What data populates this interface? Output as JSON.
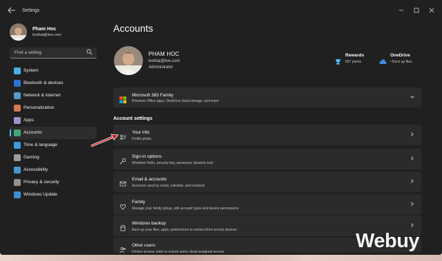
{
  "window": {
    "app_title": "Settings",
    "back_icon": "arrow-left-icon",
    "controls": [
      "minimize-icon",
      "maximize-icon",
      "close-icon"
    ]
  },
  "profile": {
    "name": "Pham Hoc",
    "email": "lexthai@live.com"
  },
  "search": {
    "placeholder": "Find a setting",
    "icon": "search-icon"
  },
  "nav": [
    {
      "label": "System",
      "icon": "monitor-icon",
      "color": "#4cc2ff",
      "active": false
    },
    {
      "label": "Bluetooth & devices",
      "icon": "bluetooth-icon",
      "color": "#2f7de1",
      "active": false
    },
    {
      "label": "Network & internet",
      "icon": "wifi-icon",
      "color": "#5aa9e6",
      "active": false
    },
    {
      "label": "Personalization",
      "icon": "brush-icon",
      "color": "#e9825a",
      "active": false
    },
    {
      "label": "Apps",
      "icon": "apps-icon",
      "color": "#b39ddb",
      "active": false
    },
    {
      "label": "Accounts",
      "icon": "person-icon",
      "color": "#43b581",
      "active": true
    },
    {
      "label": "Time & language",
      "icon": "globe-clock-icon",
      "color": "#3fa9f5",
      "active": false
    },
    {
      "label": "Gaming",
      "icon": "gamepad-icon",
      "color": "#a8a8a8",
      "active": false
    },
    {
      "label": "Accessibility",
      "icon": "accessibility-icon",
      "color": "#4aa3df",
      "active": false
    },
    {
      "label": "Privacy & security",
      "icon": "shield-icon",
      "color": "#9e9e9e",
      "active": false
    },
    {
      "label": "Windows Update",
      "icon": "update-icon",
      "color": "#3d9be9",
      "active": false
    }
  ],
  "main": {
    "title": "Accounts",
    "account": {
      "name": "PHAM HOC",
      "email": "lexthai@live.com",
      "role": "Administrator"
    },
    "rewards": {
      "title": "Rewards",
      "sub": "657 points",
      "icon": "rewards-trophy-icon"
    },
    "onedrive": {
      "title": "OneDrive",
      "sub": "• Back up files",
      "icon": "cloud-icon"
    },
    "m365": {
      "title": "Microsoft 365 Family",
      "sub": "Premium Office apps, OneDrive cloud storage, and more",
      "icon": "microsoft-logo-icon"
    },
    "section_title": "Account settings",
    "settings": [
      {
        "title": "Your info",
        "sub": "Profile photo",
        "icon": "person-card-icon"
      },
      {
        "title": "Sign-in options",
        "sub": "Windows Hello, security key, password, dynamic lock",
        "icon": "key-icon"
      },
      {
        "title": "Email & accounts",
        "sub": "Accounts used by email, calendar, and contacts",
        "icon": "mail-icon"
      },
      {
        "title": "Family",
        "sub": "Manage your family group, edit account types and device permissions",
        "icon": "heart-family-icon"
      },
      {
        "title": "Windows backup",
        "sub": "Back up your files, apps, preferences to restore them across devices",
        "icon": "backup-icon"
      },
      {
        "title": "Other users",
        "sub": "Device access, work or school users, kiosk assigned access",
        "icon": "people-icon"
      }
    ]
  },
  "watermark": "Webuy"
}
